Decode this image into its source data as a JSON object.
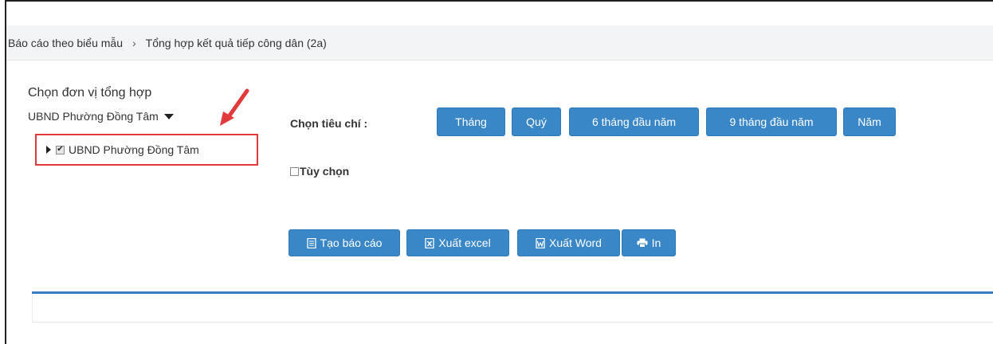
{
  "breadcrumb": {
    "parent": "Báo cáo theo biểu mẫu",
    "separator": "›",
    "current": "Tổng hợp kết quả tiếp công dân (2a)"
  },
  "unit_section": {
    "title": "Chọn đơn vị tổng hợp",
    "selected_unit": "UBND Phường Đồng Tâm",
    "tree_item": {
      "label": "UBND Phường Đồng Tâm",
      "checked": true
    }
  },
  "criteria": {
    "label": "Chọn tiêu chí :",
    "buttons": [
      "Tháng",
      "Quý",
      "6 tháng đầu năm",
      "9 tháng đầu năm",
      "Năm"
    ]
  },
  "custom_option": {
    "label": "Tùy chọn",
    "checked": false
  },
  "actions": {
    "create_report": "Tạo báo cáo",
    "export_excel": "Xuất excel",
    "export_word": "Xuất Word",
    "print": "In"
  },
  "colors": {
    "primary_button": "#3a87c8",
    "annotation": "#e23a3a",
    "divider": "#3b7dc0"
  }
}
